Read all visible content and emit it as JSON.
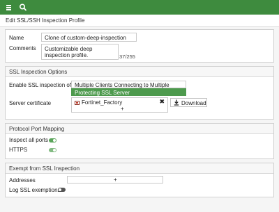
{
  "header": {
    "menu_icon": "hamburger-menu-icon",
    "search_icon": "search-icon",
    "accent_color": "#3e8b3e"
  },
  "page": {
    "title": "Edit SSL/SSH Inspection Profile"
  },
  "general": {
    "name_label": "Name",
    "name_value": "Clone of custom-deep-inspection",
    "comments_label": "Comments",
    "comments_value": "Customizable deep inspection profile.",
    "comments_counter": "37/255"
  },
  "ssl_options": {
    "heading": "SSL Inspection Options",
    "enable_label": "Enable SSL inspection of",
    "option_multiple": "Multiple Clients Connecting to Multiple Servers",
    "option_protecting": "Protecting SSL Server",
    "selected_option": "Protecting SSL Server",
    "server_cert_label": "Server certificate",
    "certificate": "Fortinet_Factory",
    "certificate_icon": "certificate-icon",
    "download_label": "Download",
    "download_icon": "download-icon"
  },
  "port_mapping": {
    "heading": "Protocol Port Mapping",
    "inspect_all_label": "Inspect all ports",
    "inspect_all_on": true,
    "https_label": "HTTPS",
    "https_on": true
  },
  "exempt": {
    "heading": "Exempt from SSL Inspection",
    "addresses_label": "Addresses",
    "add_symbol": "+",
    "log_label": "Log SSL exemptions",
    "log_on": false
  }
}
